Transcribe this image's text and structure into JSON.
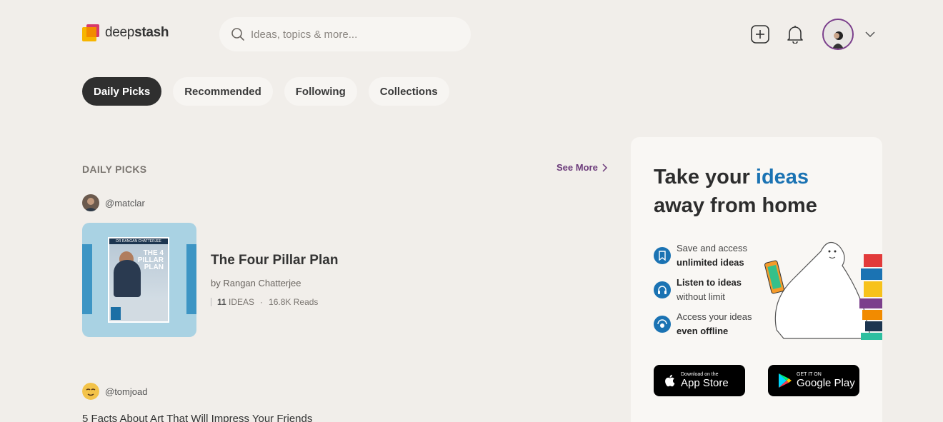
{
  "brand": {
    "name_light": "deep",
    "name_bold": "stash"
  },
  "search": {
    "placeholder": "Ideas, topics & more..."
  },
  "header": {
    "icons": [
      "add-icon",
      "bell-icon",
      "avatar",
      "chevron-down-icon"
    ]
  },
  "tabs": [
    {
      "label": "Daily Picks",
      "active": true
    },
    {
      "label": "Recommended",
      "active": false
    },
    {
      "label": "Following",
      "active": false
    },
    {
      "label": "Collections",
      "active": false
    }
  ],
  "section": {
    "title": "DAILY PICKS",
    "see_more": "See More"
  },
  "picks": [
    {
      "user": "@matclar",
      "title": "The Four Pillar Plan",
      "author": "by Rangan Chatterjee",
      "ideas_count": "11",
      "ideas_label": "IDEAS",
      "reads": "16.8K Reads",
      "cover": {
        "author_line": "DR RANGAN CHATTERJEE",
        "title_lines": "THE 4 PILLAR PLAN"
      }
    },
    {
      "user": "@tomjoad",
      "title": "5 Facts About Art That Will Impress Your Friends"
    }
  ],
  "promo": {
    "heading_part1": "Take your ",
    "heading_highlight": "ideas",
    "heading_part2": "away from home",
    "features": [
      {
        "line1": "Save and access",
        "line2": "unlimited ideas",
        "icon": "bookmark-icon"
      },
      {
        "line1": "Listen to ideas",
        "line2": "without limit",
        "icon": "headphones-icon"
      },
      {
        "line1": "Access your ideas",
        "line2": "even offline",
        "icon": "offline-icon"
      }
    ],
    "app_store": {
      "small": "Download on the",
      "big": "App Store"
    },
    "google_play": {
      "small": "GET IT ON",
      "big": "Google Play"
    }
  },
  "colors": {
    "accent": "#1b73b3",
    "see_more": "#6b3a7a",
    "background": "#f1eeea"
  }
}
